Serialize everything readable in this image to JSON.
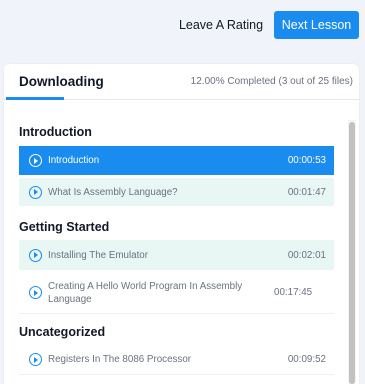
{
  "header": {
    "leave_rating_label": "Leave A Rating",
    "next_lesson_label": "Next Lesson"
  },
  "panel": {
    "tab_label": "Downloading",
    "progress_text": "12.00% Completed (3 out of 25 files)",
    "progress_fraction": 0.12
  },
  "sections": [
    {
      "title": "Introduction",
      "lessons": [
        {
          "title": "Introduction",
          "duration": "00:00:53",
          "state": "active"
        },
        {
          "title": "What Is Assembly Language?",
          "duration": "00:01:47",
          "state": "completed"
        }
      ]
    },
    {
      "title": "Getting Started",
      "lessons": [
        {
          "title": "Installing The Emulator",
          "duration": "00:02:01",
          "state": "completed"
        },
        {
          "title": "Creating A Hello World Program In Assembly Language",
          "duration": "00:17:45",
          "state": "default"
        }
      ]
    },
    {
      "title": "Uncategorized",
      "lessons": [
        {
          "title": "Registers In The 8086 Processor",
          "duration": "00:09:52",
          "state": "default"
        }
      ]
    }
  ],
  "colors": {
    "accent": "#1a8cf0",
    "completed_bg": "#e8f6f4",
    "page_bg": "#f0f3f9"
  },
  "icons": {
    "lesson": "play-circle-icon"
  }
}
